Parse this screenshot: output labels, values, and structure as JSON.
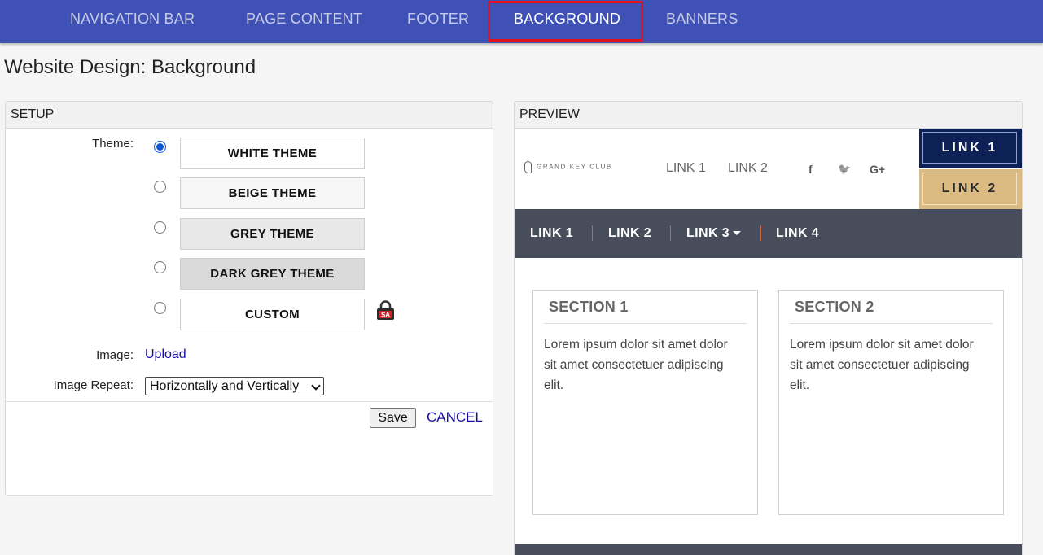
{
  "topnav": {
    "tabs": [
      {
        "label": "NAVIGATION BAR"
      },
      {
        "label": "PAGE CONTENT"
      },
      {
        "label": "FOOTER"
      },
      {
        "label": "BACKGROUND",
        "active": true
      },
      {
        "label": "BANNERS"
      }
    ],
    "color": "#3f51b5",
    "highlight_color": "#e0131b"
  },
  "page_title": "Website Design: Background",
  "setup": {
    "title": "SETUP",
    "theme_label": "Theme:",
    "themes": [
      {
        "label": "WHITE THEME",
        "selected": true,
        "color": "#ffffff"
      },
      {
        "label": "BEIGE THEME",
        "selected": false,
        "color": "#f7f7f7"
      },
      {
        "label": "GREY THEME",
        "selected": false,
        "color": "#e8e8e8"
      },
      {
        "label": "DARK GREY THEME",
        "selected": false,
        "color": "#dadada"
      },
      {
        "label": "CUSTOM",
        "selected": false,
        "color": "#ffffff"
      }
    ],
    "custom_badge": {
      "icon": "lock-icon",
      "text": "SA"
    },
    "image_label": "Image:",
    "image_link": "Upload",
    "repeat_label": "Image Repeat:",
    "repeat_value": "Horizontally and Vertically",
    "save_label": "Save",
    "cancel_label": "CANCEL"
  },
  "preview": {
    "title": "PREVIEW",
    "logo_text": "GRAND KEY CLUB",
    "header_links": [
      "LINK 1",
      "LINK 2"
    ],
    "social_icons": [
      "facebook-icon",
      "twitter-icon",
      "google-plus-icon"
    ],
    "social_glyphs": [
      "f",
      "🐦",
      "G+"
    ],
    "button_1": "LINK 1",
    "button_2": "LINK 2",
    "nav_links": [
      "LINK 1",
      "LINK 2",
      "LINK 3",
      "LINK 4"
    ],
    "sections": [
      {
        "title": "SECTION 1",
        "text": "Lorem ipsum dolor sit amet dolor sit amet consectetuer adipiscing elit."
      },
      {
        "title": "SECTION 2",
        "text": "Lorem ipsum dolor sit amet dolor sit amet consectetuer adipiscing elit."
      }
    ],
    "colors": {
      "dark_button": "#0d2157",
      "gold_button": "#dbbb82",
      "nav_bg": "#474d5b",
      "separator": "#c86442"
    }
  }
}
